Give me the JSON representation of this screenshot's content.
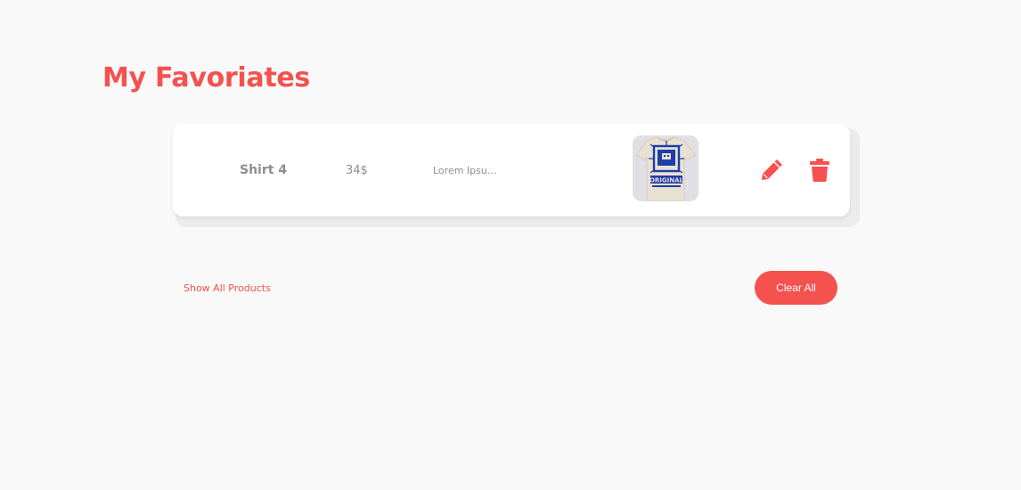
{
  "header": {
    "title": "My Favoriates"
  },
  "favorites": [
    {
      "name": "Shirt 4",
      "price": "34$",
      "description": "Lorem Ipsu...",
      "image_icon": "tshirt-original-image",
      "image_text": "ORIGINAL"
    }
  ],
  "actions": {
    "edit_icon": "pencil-icon",
    "delete_icon": "trash-icon"
  },
  "footer": {
    "show_all_label": "Show All Products",
    "clear_all_label": "Clear All"
  },
  "colors": {
    "accent": "#f4514f",
    "background": "#f8f9f8",
    "card": "#ffffff",
    "muted_text": "#8e8e8e"
  }
}
